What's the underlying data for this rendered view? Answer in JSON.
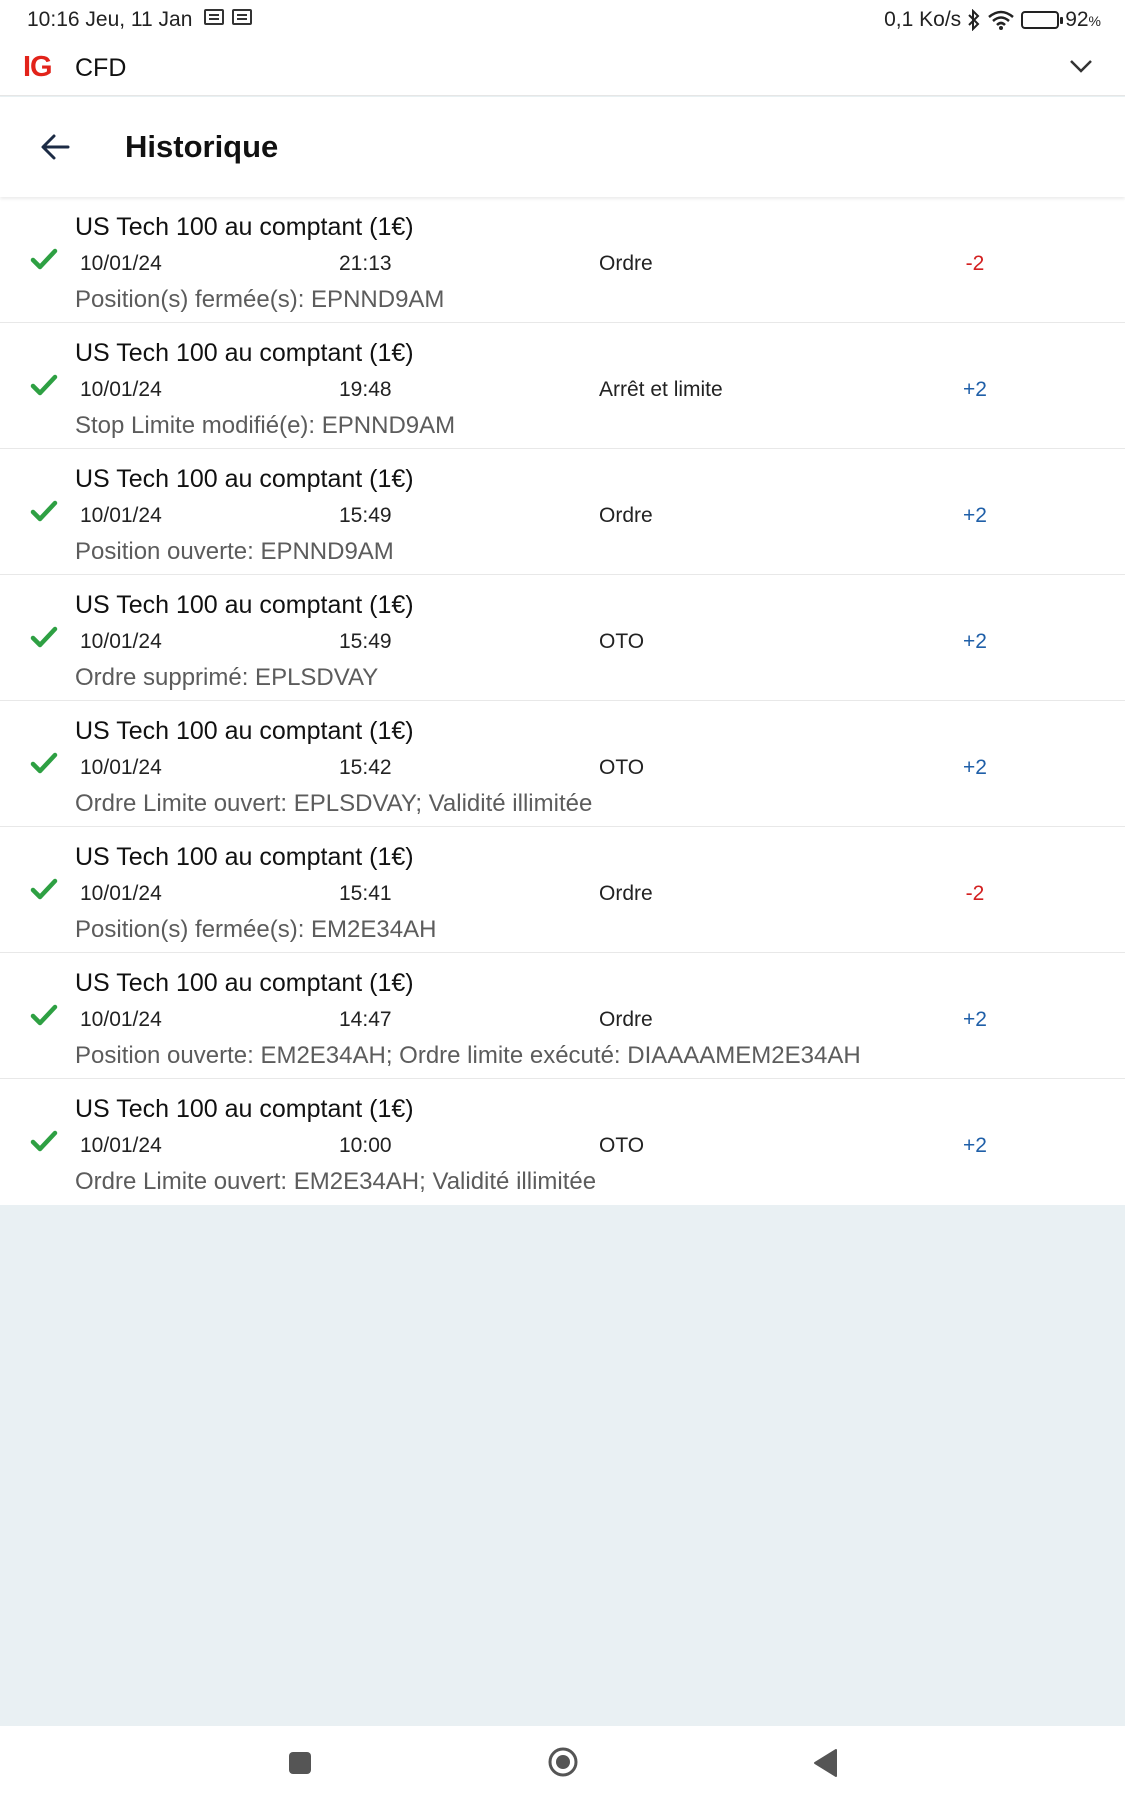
{
  "status_bar": {
    "time": "10:16 Jeu, 11 Jan",
    "net_speed": "0,1 Ko/s",
    "battery": "92",
    "battery_unit": "%",
    "battery_level": 0.92
  },
  "app_bar": {
    "logo": "IG",
    "account_type": "CFD"
  },
  "header": {
    "title": "Historique"
  },
  "colors": {
    "brand": "#e2231a",
    "check": "#2ea043",
    "negative": "#d32020",
    "positive": "#1f5fa8"
  },
  "history": [
    {
      "instrument": "US Tech 100 au comptant (1€)",
      "date": "10/01/24",
      "time": "21:13",
      "type": "Ordre",
      "qty": "-2",
      "sign": "neg",
      "description": "Position(s) fermée(s): EPNND9AM"
    },
    {
      "instrument": "US Tech 100 au comptant (1€)",
      "date": "10/01/24",
      "time": "19:48",
      "type": "Arrêt et limite",
      "qty": "+2",
      "sign": "pos",
      "description": "Stop Limite modifié(e): EPNND9AM"
    },
    {
      "instrument": "US Tech 100 au comptant (1€)",
      "date": "10/01/24",
      "time": "15:49",
      "type": "Ordre",
      "qty": "+2",
      "sign": "pos",
      "description": "Position ouverte: EPNND9AM"
    },
    {
      "instrument": "US Tech 100 au comptant (1€)",
      "date": "10/01/24",
      "time": "15:49",
      "type": "OTO",
      "qty": "+2",
      "sign": "pos",
      "description": "Ordre supprimé: EPLSDVAY"
    },
    {
      "instrument": "US Tech 100 au comptant (1€)",
      "date": "10/01/24",
      "time": "15:42",
      "type": "OTO",
      "qty": "+2",
      "sign": "pos",
      "description": "Ordre Limite ouvert: EPLSDVAY; Validité illimitée"
    },
    {
      "instrument": "US Tech 100 au comptant (1€)",
      "date": "10/01/24",
      "time": "15:41",
      "type": "Ordre",
      "qty": "-2",
      "sign": "neg",
      "description": "Position(s) fermée(s): EM2E34AH"
    },
    {
      "instrument": "US Tech 100 au comptant (1€)",
      "date": "10/01/24",
      "time": "14:47",
      "type": "Ordre",
      "qty": "+2",
      "sign": "pos",
      "description": "Position ouverte: EM2E34AH; Ordre limite exécuté: DIAAAAMEM2E34AH"
    },
    {
      "instrument": "US Tech 100 au comptant (1€)",
      "date": "10/01/24",
      "time": "10:00",
      "type": "OTO",
      "qty": "+2",
      "sign": "pos",
      "description": "Ordre Limite ouvert: EM2E34AH; Validité illimitée"
    }
  ]
}
